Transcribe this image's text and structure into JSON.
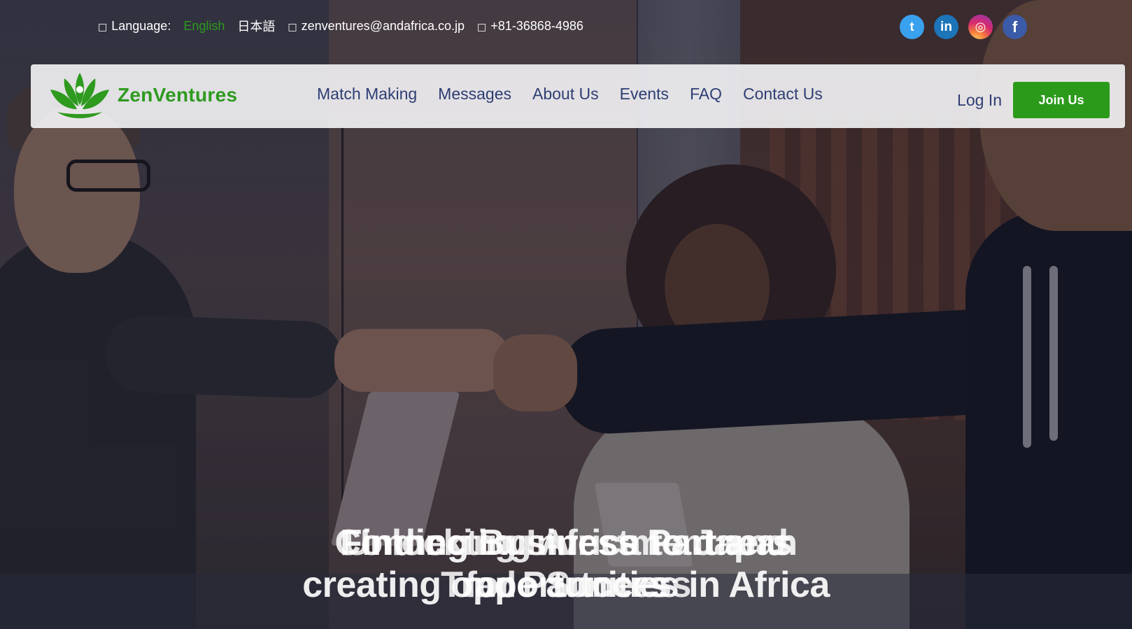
{
  "topbar": {
    "globe_glyph": "□",
    "language_label": "Language:",
    "lang_current": "English",
    "lang_alt": "日本語",
    "mail_glyph": "□",
    "email": "zenventures@andafrica.co.jp",
    "phone_glyph": "□",
    "phone": "+81-36868-4986"
  },
  "social": {
    "twitter": "t",
    "linkedin": "in",
    "instagram": "◎",
    "facebook": "f"
  },
  "brand": {
    "name": "ZenVentures"
  },
  "nav": {
    "items": [
      "Match Making",
      "Messages",
      "About Us",
      "Events",
      "FAQ",
      "Contact Us"
    ],
    "login": "Log In",
    "join": "Join Us"
  },
  "hero": {
    "slide_a": {
      "line1": "Finding Business Partners",
      "line2": "creating opportunities in Africa"
    },
    "slide_b": {
      "line1": "Connecting Africa to Japan",
      "line2": "for Partners"
    },
    "slide_c": {
      "line1": "Unlocking Investment and",
      "line2": "Trade Success"
    }
  },
  "colors": {
    "brand_green": "#2e9a1e",
    "nav_text": "#2e3e73",
    "join_button": "#2b9a1b"
  }
}
